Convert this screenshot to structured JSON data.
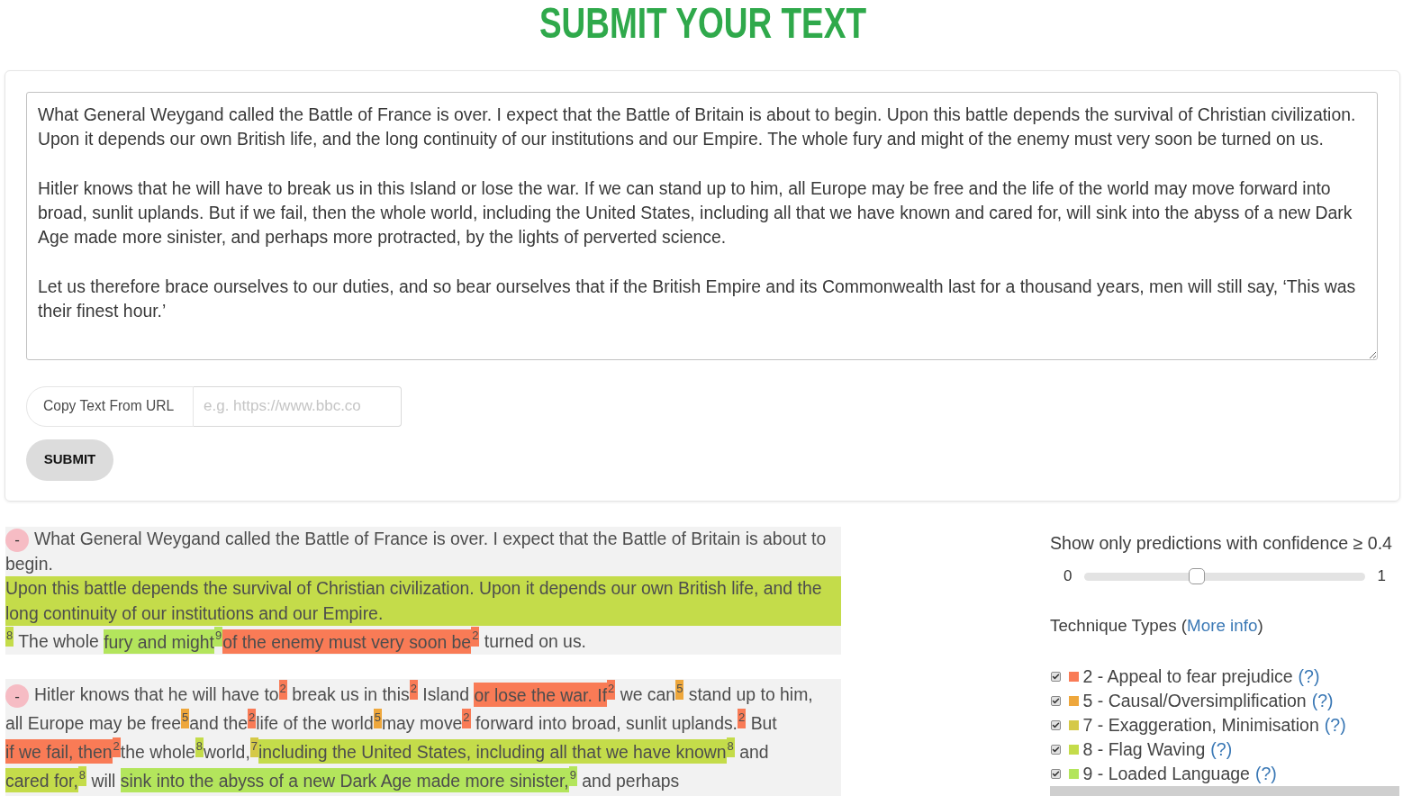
{
  "title": "SUBMIT YOUR TEXT",
  "text_input": {
    "value": "What General Weygand called the Battle of France is over. I expect that the Battle of Britain is about to begin. Upon this battle depends the survival of Christian civilization. Upon it depends our own British life, and the long continuity of our institutions and our Empire. The whole fury and might of the enemy must very soon be turned on us.\n\nHitler knows that he will have to break us in this Island or lose the war. If we can stand up to him, all Europe may be free and the life of the world may move forward into broad, sunlit uplands. But if we fail, then the whole world, including the United States, including all that we have known and cared for, will sink into the abyss of a new Dark Age made more sinister, and perhaps more protracted, by the lights of perverted science.\n\nLet us therefore brace ourselves to our duties, and so bear ourselves that if the British Empire and its Commonwealth last for a thousand years, men will still say, ‘This was their finest hour.’"
  },
  "url_field": {
    "label": "Copy Text From URL",
    "placeholder": "e.g. https://www.bbc.co"
  },
  "submit_button": "SUBMIT",
  "analysis": {
    "paragraphs": [
      {
        "toggle": "-",
        "blocks": [
          {
            "segments": [
              {
                "kind": "text",
                "text": "What General Weygand called the Battle of France is over. I expect that the Battle of Britain is about to"
              }
            ]
          },
          {
            "segments": [
              {
                "kind": "text",
                "text": "begin."
              }
            ]
          },
          {
            "segments": [
              {
                "kind": "block",
                "text": "Upon this battle depends the survival of Christian civilization. Upon it depends our own British life, and the long continuity of our institutions and our Empire.",
                "color": "#c4dc4a"
              }
            ]
          },
          {
            "segments": [
              {
                "kind": "tag",
                "text": "8",
                "color": "#c4dc4a"
              },
              {
                "kind": "text",
                "text": " The whole "
              },
              {
                "kind": "mark",
                "text": "fury and might",
                "color": "#b3e55c"
              },
              {
                "kind": "tag",
                "text": "9",
                "color": "#b3e55c"
              },
              {
                "kind": "mark",
                "text": "of the enemy must very soon be",
                "color": "#f97b56"
              },
              {
                "kind": "tag",
                "text": "2",
                "color": "#f97b56"
              },
              {
                "kind": "text",
                "text": " turned on us."
              }
            ]
          }
        ]
      },
      {
        "toggle": "-",
        "blocks": [
          {
            "segments": [
              {
                "kind": "text",
                "text": "Hitler knows that he will have to"
              },
              {
                "kind": "tag",
                "text": "2",
                "color": "#f97b56"
              },
              {
                "kind": "text",
                "text": " break us in this"
              },
              {
                "kind": "tag",
                "text": "2",
                "color": "#f97b56"
              },
              {
                "kind": "text",
                "text": " Island "
              },
              {
                "kind": "mark",
                "text": "or lose the war. If",
                "color": "#f97b56"
              },
              {
                "kind": "tag",
                "text": "2",
                "color": "#f97b56"
              },
              {
                "kind": "text",
                "text": " we can"
              },
              {
                "kind": "tag",
                "text": "5",
                "color": "#eea73c"
              },
              {
                "kind": "text",
                "text": " stand up to him,"
              }
            ]
          },
          {
            "segments": [
              {
                "kind": "text",
                "text": "all Europe may be free"
              },
              {
                "kind": "tag",
                "text": "5",
                "color": "#eea73c"
              },
              {
                "kind": "text",
                "text": "and the"
              },
              {
                "kind": "tag",
                "text": "2",
                "color": "#f97b56"
              },
              {
                "kind": "text",
                "text": "life of the world"
              },
              {
                "kind": "tag",
                "text": "5",
                "color": "#eea73c"
              },
              {
                "kind": "text",
                "text": "may move"
              },
              {
                "kind": "tag",
                "text": "2",
                "color": "#f97b56"
              },
              {
                "kind": "text",
                "text": " forward into broad, sunlit uplands."
              },
              {
                "kind": "tag",
                "text": "2",
                "color": "#f97b56"
              },
              {
                "kind": "text",
                "text": " But"
              }
            ]
          },
          {
            "segments": [
              {
                "kind": "mark",
                "text": "if we fail, then",
                "color": "#f97b56"
              },
              {
                "kind": "tag",
                "text": "2",
                "color": "#f97b56"
              },
              {
                "kind": "text",
                "text": "the whole"
              },
              {
                "kind": "tag",
                "text": "8",
                "color": "#c4dc4a"
              },
              {
                "kind": "text",
                "text": "world,"
              },
              {
                "kind": "tag",
                "text": "7",
                "color": "#d5c947"
              },
              {
                "kind": "mark",
                "text": "including the United States, including all that we have known",
                "color": "#c4dc4a"
              },
              {
                "kind": "tag",
                "text": "8",
                "color": "#c4dc4a"
              },
              {
                "kind": "text",
                "text": " and"
              }
            ]
          },
          {
            "segments": [
              {
                "kind": "mark",
                "text": "cared for,",
                "color": "#c4dc4a"
              },
              {
                "kind": "tag",
                "text": "8",
                "color": "#c4dc4a"
              },
              {
                "kind": "text",
                "text": " will "
              },
              {
                "kind": "mark",
                "text": "sink into the abyss of a new Dark Age made more sinister,",
                "color": "#b3e55c"
              },
              {
                "kind": "tag",
                "text": "9",
                "color": "#b3e55c"
              },
              {
                "kind": "text",
                "text": " and perhaps"
              }
            ]
          }
        ]
      }
    ]
  },
  "confidence_filter": {
    "label": "Show only predictions with confidence ≥ 0.4",
    "min_label": "0",
    "max_label": "1",
    "level": 0.4
  },
  "technique_types": {
    "prefix": "Technique Types (",
    "link": "More info",
    "suffix": ")",
    "items": [
      {
        "checked": true,
        "color": "#f97b56",
        "label": "2 - Appeal to fear prejudice",
        "help": "(?)"
      },
      {
        "checked": true,
        "color": "#eea73c",
        "label": "5 - Causal/Oversimplification",
        "help": "(?)"
      },
      {
        "checked": true,
        "color": "#d5c947",
        "label": "7 - Exaggeration, Minimisation",
        "help": "(?)"
      },
      {
        "checked": true,
        "color": "#c4dc4a",
        "label": "8 - Flag Waving",
        "help": "(?)"
      },
      {
        "checked": true,
        "color": "#b3e55c",
        "label": "9 - Loaded Language",
        "help": "(?)"
      }
    ]
  }
}
